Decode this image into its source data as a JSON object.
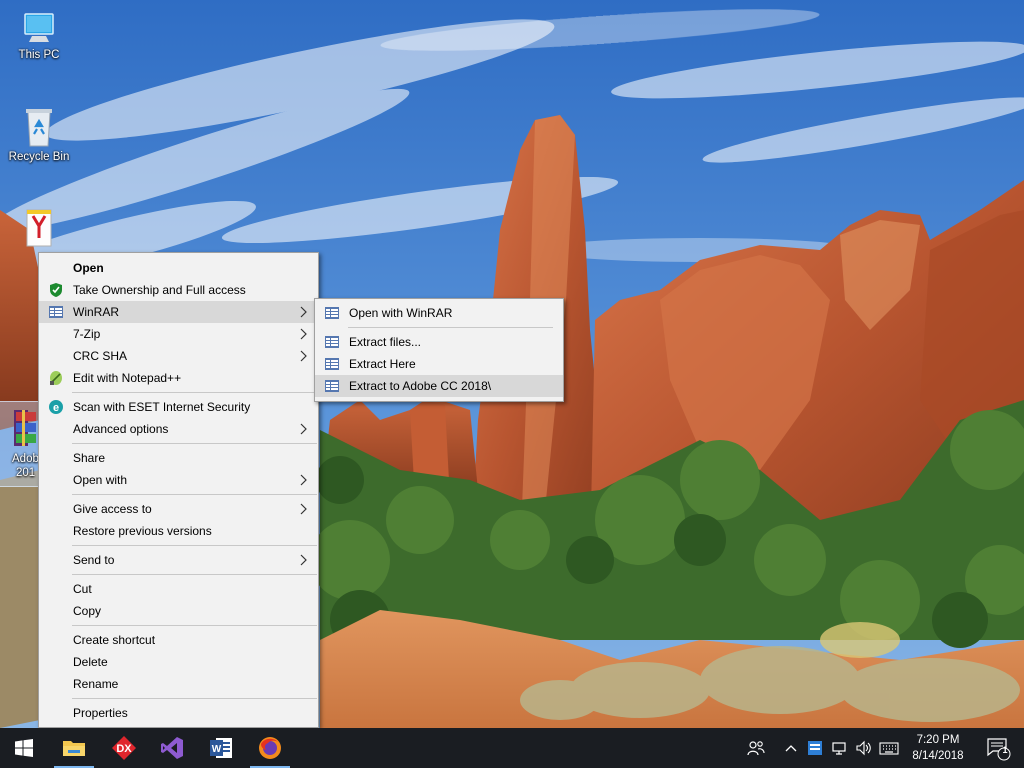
{
  "desktop": {
    "icons": [
      {
        "label": "This PC",
        "icon": "monitor-icon"
      },
      {
        "label": "Recycle Bin",
        "icon": "recycle-bin-icon"
      },
      {
        "label": "",
        "icon": "document-icon"
      },
      {
        "label": "Adob",
        "label2": "201",
        "icon": "winrar-archive-icon"
      }
    ]
  },
  "context_menu": {
    "items": [
      {
        "label": "Open",
        "bold": true
      },
      {
        "label": "Take Ownership and Full access",
        "icon": "shield-icon"
      },
      {
        "label": "WinRAR",
        "icon": "winrar-icon",
        "submenu": true,
        "highlighted": true
      },
      {
        "label": "7-Zip",
        "submenu": true
      },
      {
        "label": "CRC SHA",
        "submenu": true
      },
      {
        "label": "Edit with Notepad++",
        "icon": "notepad-plus-plus-icon"
      },
      {
        "label": "Scan with ESET Internet Security",
        "icon": "eset-icon"
      },
      {
        "label": "Advanced options",
        "submenu": true
      },
      {
        "label": "Share"
      },
      {
        "label": "Open with",
        "submenu": true
      },
      {
        "label": "Give access to",
        "submenu": true
      },
      {
        "label": "Restore previous versions"
      },
      {
        "label": "Send to",
        "submenu": true
      },
      {
        "label": "Cut"
      },
      {
        "label": "Copy"
      },
      {
        "label": "Create shortcut"
      },
      {
        "label": "Delete"
      },
      {
        "label": "Rename"
      },
      {
        "label": "Properties"
      }
    ]
  },
  "winrar_submenu": {
    "items": [
      {
        "label": "Open with WinRAR",
        "icon": "winrar-icon"
      },
      {
        "label": "Extract files...",
        "icon": "winrar-icon"
      },
      {
        "label": "Extract Here",
        "icon": "winrar-icon"
      },
      {
        "label": "Extract to Adobe CC 2018\\",
        "icon": "winrar-icon",
        "highlighted": true
      }
    ]
  },
  "taskbar": {
    "pinned": [
      {
        "name": "start-button",
        "icon": "windows-logo-icon"
      },
      {
        "name": "file-explorer-button",
        "icon": "folder-icon",
        "running": true
      },
      {
        "name": "devexpress-button",
        "icon": "dx-icon"
      },
      {
        "name": "visual-studio-button",
        "icon": "visual-studio-icon"
      },
      {
        "name": "word-button",
        "icon": "word-icon"
      },
      {
        "name": "firefox-button",
        "icon": "firefox-icon",
        "running": true
      }
    ],
    "dx_label": "DX",
    "word_label": "W",
    "clock": {
      "time": "7:20 PM",
      "date": "8/14/2018"
    },
    "notification_count": "1"
  },
  "colors": {
    "menu_bg": "#f2f2f2",
    "menu_highlight": "#d8d8d8",
    "taskbar_bg": "#1a1d22",
    "accent": "#7db7f0"
  }
}
